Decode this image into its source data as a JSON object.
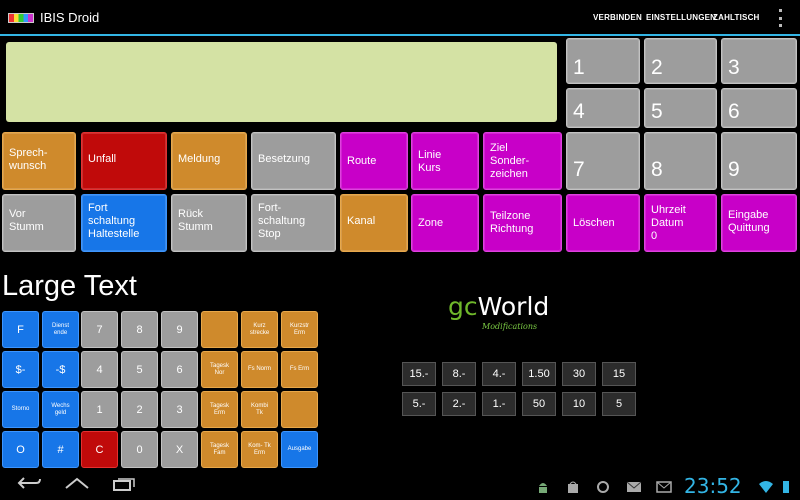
{
  "app": {
    "title": "IBIS Droid"
  },
  "menu": [
    "VERBINDEN",
    "EINSTELLUNGEN",
    "ZAHLTISCH"
  ],
  "colors": {
    "orange": "#cf8a2c",
    "red": "#c00a0a",
    "gray": "#9d9d9d",
    "magenta": "#c800c8",
    "blue": "#1776e8",
    "display": "#d4e2a4",
    "accent": "#33b5e5"
  },
  "numpad": [
    "1",
    "2",
    "3",
    "4",
    "5",
    "6",
    "7",
    "8",
    "9"
  ],
  "functions_row1": [
    "Sprech-\nwunsch",
    "Unfall",
    "Meldung",
    "Besetzung",
    "Route",
    "Linie\nKurs",
    "Ziel\nSonder-\nzeichen"
  ],
  "functions_row2": [
    "Vor\nStumm",
    "Fort\nschaltung\nHaltestelle",
    "Rück\nStumm",
    "Fort-\nschaltung\nStop",
    "Kanal",
    "Zone",
    "Teilzone\nRichtung",
    "Löschen",
    "Uhrzeit\nDatum\n0",
    "Eingabe\nQuittung"
  ],
  "large_text_label": "Large Text",
  "keypad": {
    "row1": [
      "F",
      "Dienst\nende",
      "7",
      "8",
      "9",
      "",
      "Kurz\nstrecke",
      "Kurzstr\nErm"
    ],
    "row2": [
      "$-",
      "-$",
      "4",
      "5",
      "6",
      "Tagesk\nNor",
      "Fs Norm",
      "Fs Erm"
    ],
    "row3": [
      "Storno",
      "Wechs\ngeld",
      "1",
      "2",
      "3",
      "Tagesk\nErm",
      "Kombi\nTk",
      ""
    ],
    "row4": [
      "O",
      "#",
      "C",
      "0",
      "X",
      "Tagesk\nFam",
      "Kom- Tk\nErm",
      "Ausgabe"
    ]
  },
  "logo": {
    "g": "gc",
    "w": "World",
    "sub": "Modifications"
  },
  "coins": {
    "row1": [
      "15.-",
      "8.-",
      "4.-",
      "1.50",
      "30",
      "15"
    ],
    "row2": [
      "5.-",
      "2.-",
      "1.-",
      "50",
      "10",
      "5"
    ]
  },
  "status": {
    "clock": "23:52"
  }
}
